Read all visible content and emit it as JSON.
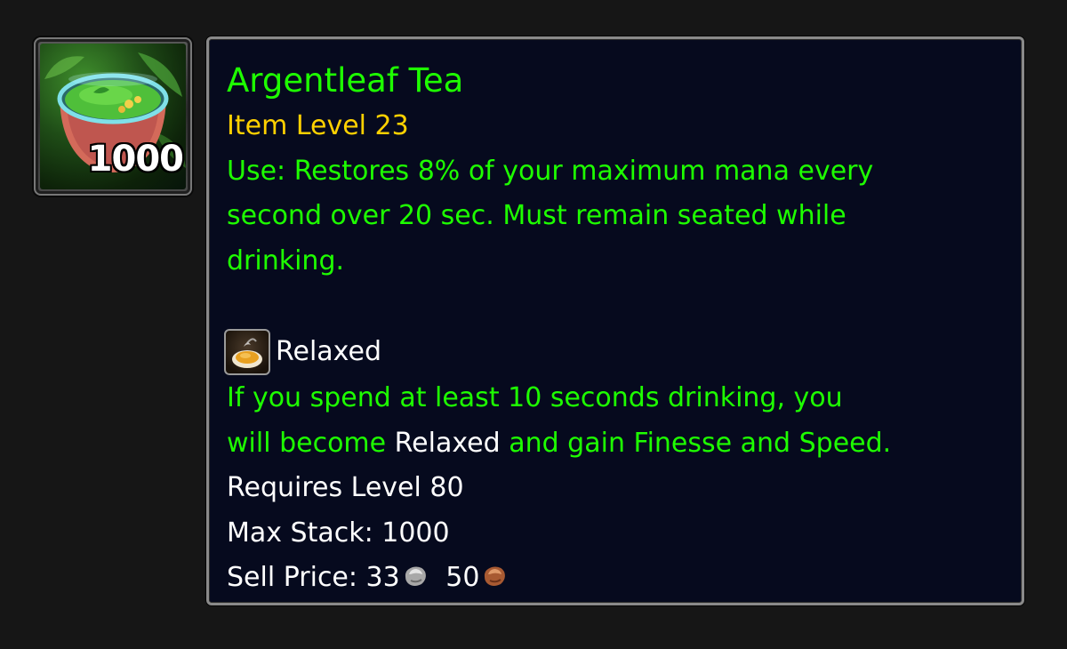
{
  "item": {
    "icon_name": "argentleaf-tea-icon",
    "stack_count": "1000",
    "name": "Argentleaf Tea",
    "item_level": "Item Level 23",
    "use_lines": [
      "Use: Restores 8% of your maximum mana every",
      "second over 20 sec. Must remain seated while",
      "drinking."
    ],
    "buff": {
      "icon_name": "relaxed-buff-icon",
      "label": "Relaxed"
    },
    "buff_desc": {
      "line1": "If you spend at least 10 seconds drinking, you",
      "line2_prefix": "will become ",
      "line2_highlight": "Relaxed",
      "line2_suffix": " and gain Finesse and Speed."
    },
    "requires": "Requires Level 80",
    "max_stack": "Max Stack: 1000",
    "sell_price": {
      "label": "Sell Price: ",
      "silver": "33",
      "copper": "50",
      "silver_icon": "silver-coin-icon",
      "copper_icon": "copper-coin-icon"
    }
  },
  "colors": {
    "background": "#161616",
    "tooltip_bg": "#060a1e",
    "tooltip_border": "#8a8a8a",
    "uncommon_green": "#1eff00",
    "item_level_yellow": "#ffd100",
    "white": "#ffffff"
  }
}
